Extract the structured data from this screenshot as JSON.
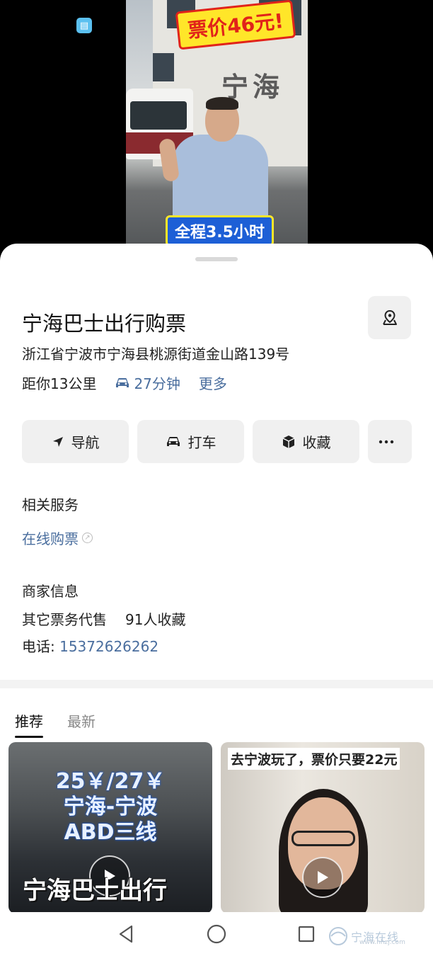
{
  "hero": {
    "banner_top": "票价46元!",
    "banner_bottom": "全程3.5小时",
    "sign_text": "宁海",
    "app_badge_icon": "book-icon"
  },
  "place": {
    "title": "宁海巴士出行购票",
    "address": "浙江省宁波市宁海县桃源街道金山路139号",
    "distance": "距你13公里",
    "drive_time": "27分钟",
    "more": "更多"
  },
  "actions": {
    "navigate": "导航",
    "taxi": "打车",
    "favorite": "收藏",
    "more_icon": "ellipsis-icon"
  },
  "services": {
    "heading": "相关服务",
    "online_ticket": "在线购票"
  },
  "merchant": {
    "heading": "商家信息",
    "category": "其它票务代售",
    "favorites": "91人收藏",
    "phone_label": "电话: ",
    "phone": "15372626262"
  },
  "tabs": {
    "recommended": "推荐",
    "latest": "最新"
  },
  "cards": {
    "card1_line1": "25￥/27￥",
    "card1_line2": "宁海-宁波",
    "card1_line3": "ABD三线",
    "card1_big": "宁海巴士出行",
    "card2_caption": "去宁波玩了，票价只要22元"
  },
  "watermark": {
    "text": "宁海在线",
    "url": "www.nhzj.com"
  },
  "colors": {
    "link": "#4a6e9e",
    "button_bg": "#f0f0f0"
  }
}
